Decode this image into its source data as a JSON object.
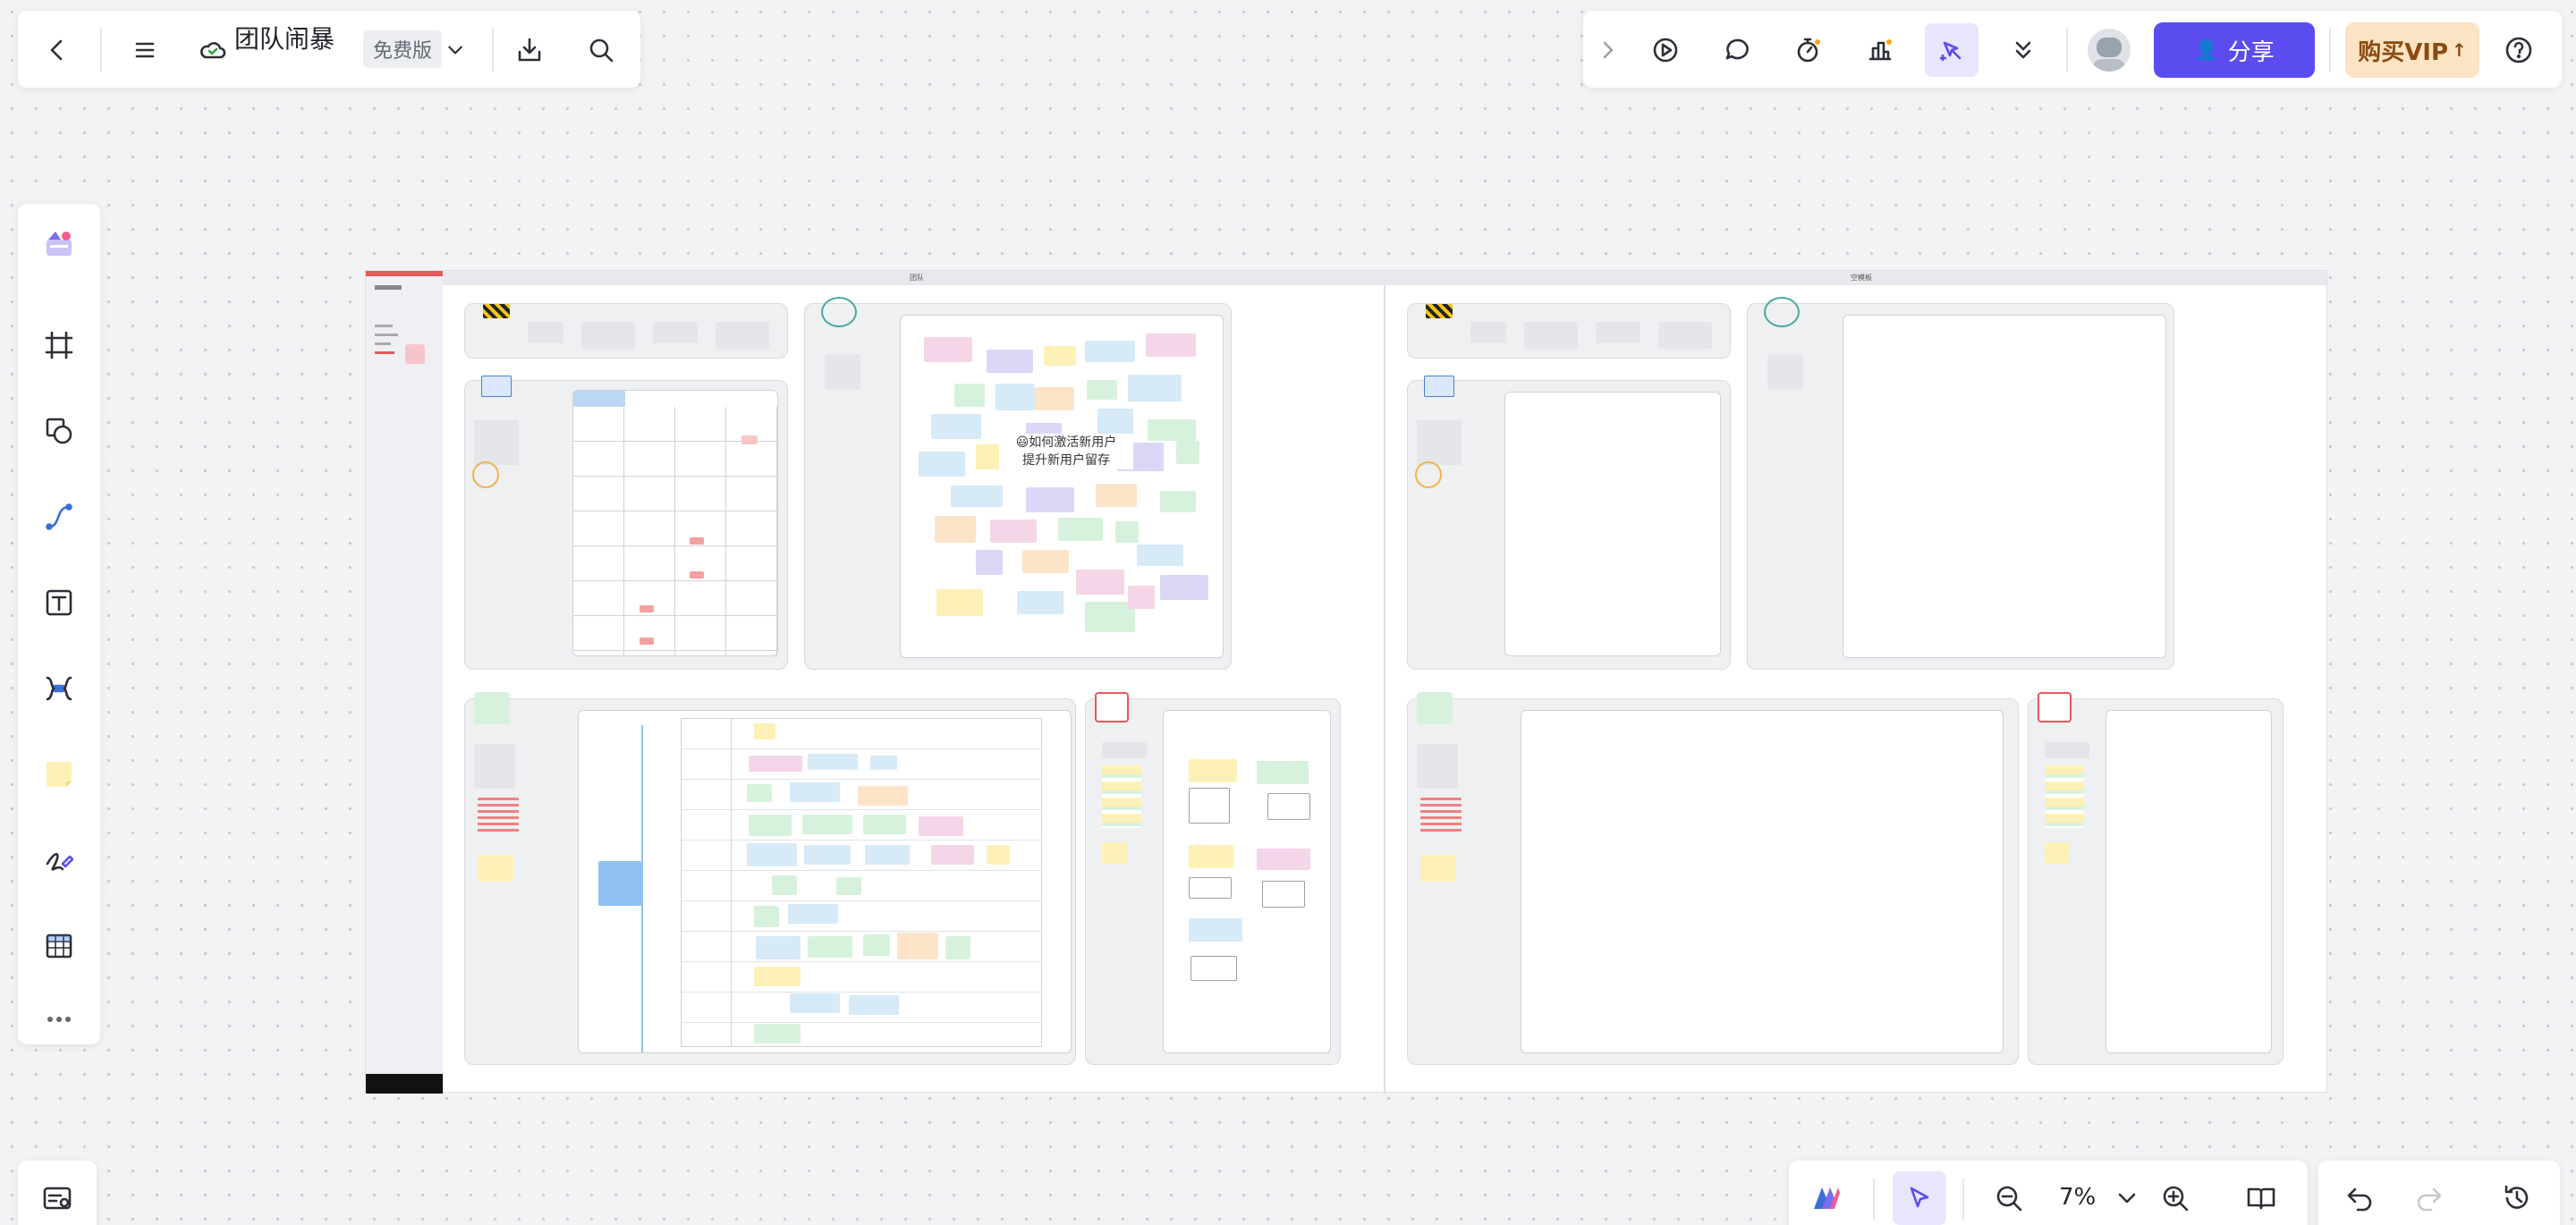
{
  "header": {
    "doc_title": "团队闹暴",
    "plan_badge": "免费版",
    "share_label": "分享",
    "vip_label": "购买VIP"
  },
  "board": {
    "frame_title_left": "团队",
    "frame_title_right": "空模板",
    "mind_center_line1": "😃如何激活新用户",
    "mind_center_line2": "提升新用户留存"
  },
  "zoom": {
    "level": "7%"
  },
  "colors": {
    "accent": "#5b4cf0",
    "vip_bg": "#fbe3c3",
    "sticky_yellow": "#fdf1b8",
    "sticky_green": "#d7f2dc",
    "sticky_purple": "#dcd7f7",
    "sticky_blue": "#d6eaf8"
  }
}
